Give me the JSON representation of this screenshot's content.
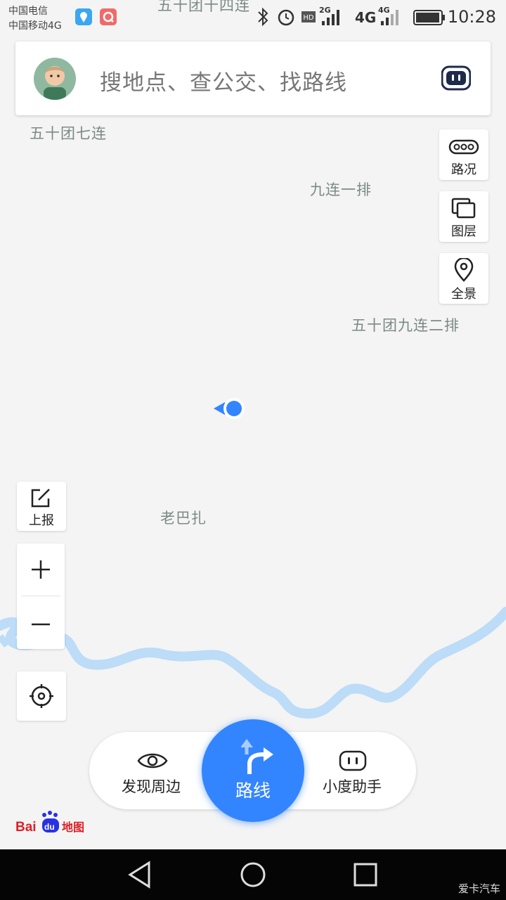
{
  "status_bar": {
    "carrier_1": "中国电信",
    "carrier_2": "中国移动4G",
    "icons": [
      "location-app-icon",
      "q-app-icon",
      "bluetooth-icon",
      "alarm-icon",
      "hd-icon",
      "signal-2g-icon",
      "network-4g-icon",
      "signal-4g-icon",
      "battery-icon"
    ],
    "hd": "HD",
    "net_2g": "2G",
    "net_4g": "4G",
    "net_4g_small": "4G",
    "time": "10:28"
  },
  "map": {
    "places": [
      "五十团十四连",
      "五十团七连",
      "九连一排",
      "五十团九连二排",
      "老巴扎"
    ],
    "colors": {
      "background": "#f4f4f4",
      "river": "#bcdcf8",
      "location": "#3385ff",
      "label": "#7b8a86"
    }
  },
  "search": {
    "placeholder": "搜地点、查公交、找路线",
    "avatar_icon": "user-avatar",
    "assistant_icon": "robot-face-icon"
  },
  "controls": {
    "traffic": "路况",
    "layers": "图层",
    "panorama": "全景",
    "report": "上报",
    "zoom_in_icon": "plus-icon",
    "zoom_out_icon": "minus-icon",
    "locate_icon": "crosshair-icon"
  },
  "bottom": {
    "discover": "发现周边",
    "route": "路线",
    "assistant": "小度助手",
    "accent": "#3385ff"
  },
  "logo": {
    "text_1": "Bai",
    "text_2": "du",
    "text_3": "地图"
  },
  "nav": {
    "icons": [
      "back-icon",
      "home-icon",
      "recents-icon"
    ]
  },
  "watermark": "爱卡汽车"
}
